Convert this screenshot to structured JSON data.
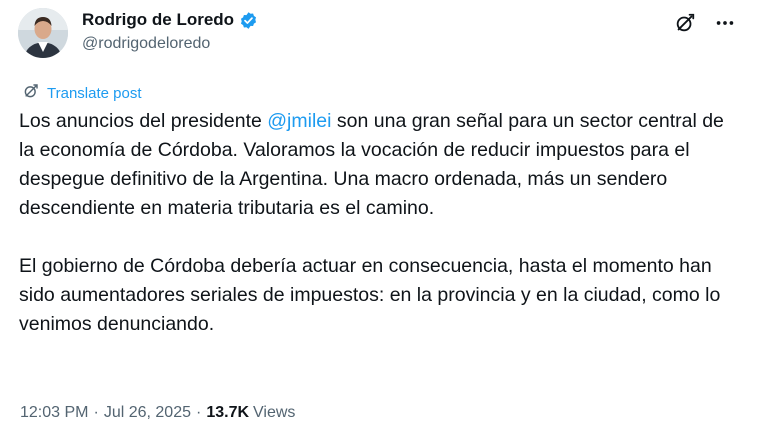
{
  "author": {
    "display_name": "Rodrigo de Loredo",
    "handle": "@rodrigodeloredo",
    "verified": true,
    "verified_color": "#1d9bf0"
  },
  "actions": {
    "grok_icon": "grok-icon",
    "more_label": "···"
  },
  "translate": {
    "label": "Translate post",
    "icon": "translate-icon"
  },
  "post": {
    "p1_before": "Los anuncios del presidente ",
    "mention": "@jmilei",
    "p1_after": " son una gran señal para un sector central de la economía de Córdoba. Valoramos la vocación de reducir impuestos para el despegue definitivo de la Argentina. Una macro ordenada, más un sendero descendiente en materia tributaria es el camino.",
    "p2": "El gobierno de Córdoba debería actuar en consecuencia, hasta el momento han sido aumentadores seriales de impuestos: en la provincia y en la ciudad, como lo venimos denunciando."
  },
  "meta": {
    "time": "12:03 PM",
    "separator": "·",
    "date": "Jul 26, 2025",
    "views_count": "13.7K",
    "views_label": "Views"
  },
  "colors": {
    "link": "#1d9bf0",
    "secondary_text": "#536471",
    "primary_text": "#0f1419"
  }
}
